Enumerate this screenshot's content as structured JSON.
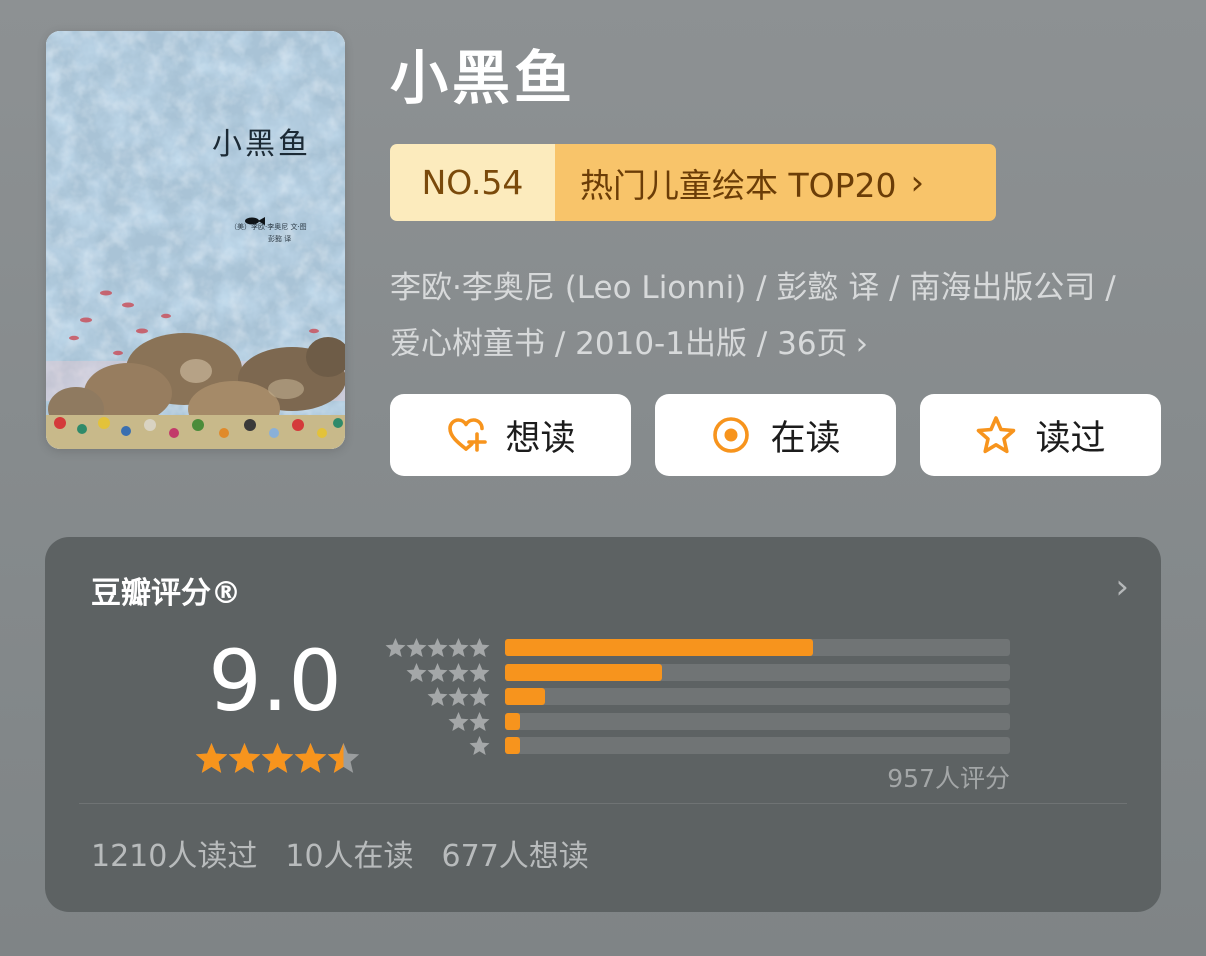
{
  "book": {
    "title": "小黑鱼",
    "cover": {
      "title": "小黑鱼",
      "credit_line": "（美）李欧·李奥尼 文·图",
      "translator_line": "彭懿 译"
    },
    "rank": {
      "number": "NO.54",
      "list_name": "热门儿童绘本 TOP20",
      "chevron": "›"
    },
    "meta": {
      "line1": "李欧·李奥尼 (Leo Lionni) / 彭懿 译 / 南海出版公司 /",
      "line2": "爱心树童书 / 2010-1出版 / 36页",
      "chevron": "›"
    }
  },
  "actions": {
    "want": {
      "label": "想读",
      "icon": "heart-plus-icon"
    },
    "reading": {
      "label": "在读",
      "icon": "target-circle-icon"
    },
    "read": {
      "label": "读过",
      "icon": "star-outline-icon"
    }
  },
  "rating": {
    "title": "豆瓣评分®",
    "more_chevron": "›",
    "score": "9.0",
    "score_stars": 4.5,
    "distribution": [
      {
        "stars": 5,
        "fraction": 0.61
      },
      {
        "stars": 4,
        "fraction": 0.31
      },
      {
        "stars": 3,
        "fraction": 0.08
      },
      {
        "stars": 2,
        "fraction": 0.03
      },
      {
        "stars": 1,
        "fraction": 0.03
      }
    ],
    "count": "957人评分"
  },
  "reader_stats": {
    "read": "1210人读过",
    "reading": "10人在读",
    "want": "677人想读"
  },
  "colors": {
    "accent": "#f7941d",
    "badge_left": "#fcebbd",
    "badge_right": "#f8c46a",
    "card_bg": "#5d6263"
  }
}
